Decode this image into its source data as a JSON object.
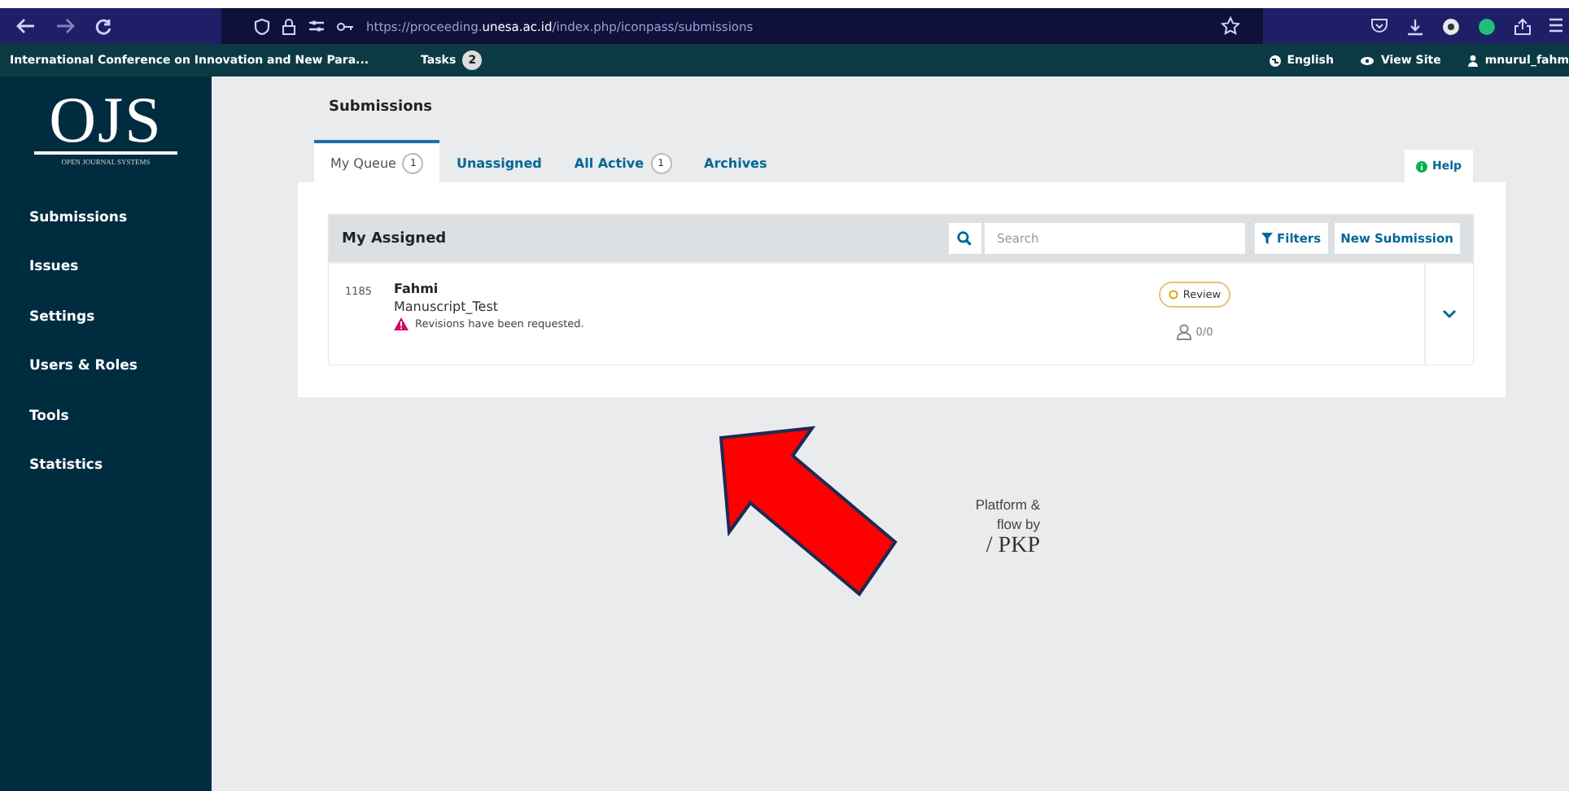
{
  "browser": {
    "url": "https://proceeding.**unesa.ac.id**/index.php/iconpass/submissions"
  },
  "topbar": {
    "site": "International Conference on Innovation and New Para...",
    "tasks_label": "Tasks",
    "tasks_count": "2",
    "language": "English",
    "view_site": "View Site",
    "user": "mnurul_fahm"
  },
  "logo": {
    "title": "OJS",
    "subtitle": "OPEN JOURNAL SYSTEMS"
  },
  "sidebar": {
    "items": [
      "Submissions",
      "Issues",
      "Settings",
      "Users & Roles",
      "Tools",
      "Statistics"
    ]
  },
  "page_title": "Submissions",
  "tabs": [
    {
      "label": "My Queue",
      "count": "1",
      "selected": true
    },
    {
      "label": "Unassigned",
      "selected": false
    },
    {
      "label": "All Active",
      "count": "1",
      "selected": false
    },
    {
      "label": "Archives",
      "selected": false
    }
  ],
  "help": "Help",
  "list": {
    "title": "My Assigned",
    "search": {
      "placeholder": "Search"
    },
    "filters": "Filters",
    "new_submission": "New Submission",
    "rows": [
      {
        "id": "1185",
        "author": "Fahmi",
        "title": "Manuscript_Test",
        "notice": "Revisions have been requested.",
        "stage": "Review",
        "files": "0/0",
        "expanded": false
      }
    ]
  },
  "footer": {
    "lines": [
      "Platform &",
      "flow by",
      "/ PKP"
    ]
  }
}
